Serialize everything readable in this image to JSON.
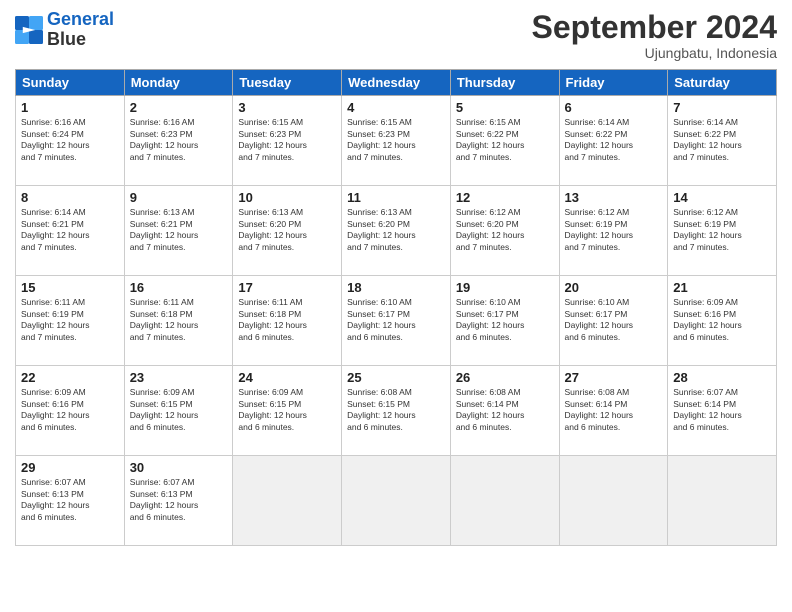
{
  "logo": {
    "line1": "General",
    "line2": "Blue"
  },
  "title": "September 2024",
  "location": "Ujungbatu, Indonesia",
  "header": {
    "days": [
      "Sunday",
      "Monday",
      "Tuesday",
      "Wednesday",
      "Thursday",
      "Friday",
      "Saturday"
    ]
  },
  "weeks": [
    [
      {
        "day": 1,
        "info": "Sunrise: 6:16 AM\nSunset: 6:24 PM\nDaylight: 12 hours\nand 7 minutes."
      },
      {
        "day": 2,
        "info": "Sunrise: 6:16 AM\nSunset: 6:23 PM\nDaylight: 12 hours\nand 7 minutes."
      },
      {
        "day": 3,
        "info": "Sunrise: 6:15 AM\nSunset: 6:23 PM\nDaylight: 12 hours\nand 7 minutes."
      },
      {
        "day": 4,
        "info": "Sunrise: 6:15 AM\nSunset: 6:23 PM\nDaylight: 12 hours\nand 7 minutes."
      },
      {
        "day": 5,
        "info": "Sunrise: 6:15 AM\nSunset: 6:22 PM\nDaylight: 12 hours\nand 7 minutes."
      },
      {
        "day": 6,
        "info": "Sunrise: 6:14 AM\nSunset: 6:22 PM\nDaylight: 12 hours\nand 7 minutes."
      },
      {
        "day": 7,
        "info": "Sunrise: 6:14 AM\nSunset: 6:22 PM\nDaylight: 12 hours\nand 7 minutes."
      }
    ],
    [
      {
        "day": 8,
        "info": "Sunrise: 6:14 AM\nSunset: 6:21 PM\nDaylight: 12 hours\nand 7 minutes."
      },
      {
        "day": 9,
        "info": "Sunrise: 6:13 AM\nSunset: 6:21 PM\nDaylight: 12 hours\nand 7 minutes."
      },
      {
        "day": 10,
        "info": "Sunrise: 6:13 AM\nSunset: 6:20 PM\nDaylight: 12 hours\nand 7 minutes."
      },
      {
        "day": 11,
        "info": "Sunrise: 6:13 AM\nSunset: 6:20 PM\nDaylight: 12 hours\nand 7 minutes."
      },
      {
        "day": 12,
        "info": "Sunrise: 6:12 AM\nSunset: 6:20 PM\nDaylight: 12 hours\nand 7 minutes."
      },
      {
        "day": 13,
        "info": "Sunrise: 6:12 AM\nSunset: 6:19 PM\nDaylight: 12 hours\nand 7 minutes."
      },
      {
        "day": 14,
        "info": "Sunrise: 6:12 AM\nSunset: 6:19 PM\nDaylight: 12 hours\nand 7 minutes."
      }
    ],
    [
      {
        "day": 15,
        "info": "Sunrise: 6:11 AM\nSunset: 6:19 PM\nDaylight: 12 hours\nand 7 minutes."
      },
      {
        "day": 16,
        "info": "Sunrise: 6:11 AM\nSunset: 6:18 PM\nDaylight: 12 hours\nand 7 minutes."
      },
      {
        "day": 17,
        "info": "Sunrise: 6:11 AM\nSunset: 6:18 PM\nDaylight: 12 hours\nand 6 minutes."
      },
      {
        "day": 18,
        "info": "Sunrise: 6:10 AM\nSunset: 6:17 PM\nDaylight: 12 hours\nand 6 minutes."
      },
      {
        "day": 19,
        "info": "Sunrise: 6:10 AM\nSunset: 6:17 PM\nDaylight: 12 hours\nand 6 minutes."
      },
      {
        "day": 20,
        "info": "Sunrise: 6:10 AM\nSunset: 6:17 PM\nDaylight: 12 hours\nand 6 minutes."
      },
      {
        "day": 21,
        "info": "Sunrise: 6:09 AM\nSunset: 6:16 PM\nDaylight: 12 hours\nand 6 minutes."
      }
    ],
    [
      {
        "day": 22,
        "info": "Sunrise: 6:09 AM\nSunset: 6:16 PM\nDaylight: 12 hours\nand 6 minutes."
      },
      {
        "day": 23,
        "info": "Sunrise: 6:09 AM\nSunset: 6:15 PM\nDaylight: 12 hours\nand 6 minutes."
      },
      {
        "day": 24,
        "info": "Sunrise: 6:09 AM\nSunset: 6:15 PM\nDaylight: 12 hours\nand 6 minutes."
      },
      {
        "day": 25,
        "info": "Sunrise: 6:08 AM\nSunset: 6:15 PM\nDaylight: 12 hours\nand 6 minutes."
      },
      {
        "day": 26,
        "info": "Sunrise: 6:08 AM\nSunset: 6:14 PM\nDaylight: 12 hours\nand 6 minutes."
      },
      {
        "day": 27,
        "info": "Sunrise: 6:08 AM\nSunset: 6:14 PM\nDaylight: 12 hours\nand 6 minutes."
      },
      {
        "day": 28,
        "info": "Sunrise: 6:07 AM\nSunset: 6:14 PM\nDaylight: 12 hours\nand 6 minutes."
      }
    ],
    [
      {
        "day": 29,
        "info": "Sunrise: 6:07 AM\nSunset: 6:13 PM\nDaylight: 12 hours\nand 6 minutes."
      },
      {
        "day": 30,
        "info": "Sunrise: 6:07 AM\nSunset: 6:13 PM\nDaylight: 12 hours\nand 6 minutes."
      },
      null,
      null,
      null,
      null,
      null
    ]
  ]
}
